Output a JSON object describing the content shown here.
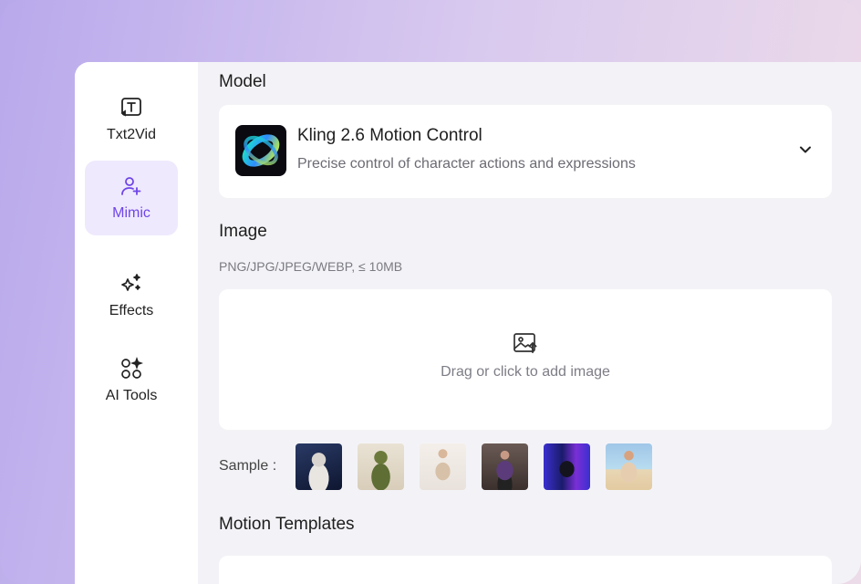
{
  "sidebar": {
    "items": [
      {
        "label": "Txt2Vid",
        "icon": "text-to-video-icon"
      },
      {
        "label": "Mimic",
        "icon": "user-sparkle-icon",
        "active": true
      },
      {
        "label": "Effects",
        "icon": "sparkles-icon"
      },
      {
        "label": "AI Tools",
        "icon": "tools-grid-icon"
      }
    ]
  },
  "model": {
    "section_title": "Model",
    "name": "Kling 2.6 Motion Control",
    "description": "Precise control of character actions and expressions"
  },
  "image": {
    "section_title": "Image",
    "hint": "PNG/JPG/JPEG/WEBP, ≤ 10MB",
    "upload_text": "Drag or click to add image",
    "sample_label": "Sample :"
  },
  "motion_templates": {
    "section_title": "Motion Templates"
  },
  "colors": {
    "accent": "#6e45e8",
    "active_bg": "#efe9fd"
  }
}
